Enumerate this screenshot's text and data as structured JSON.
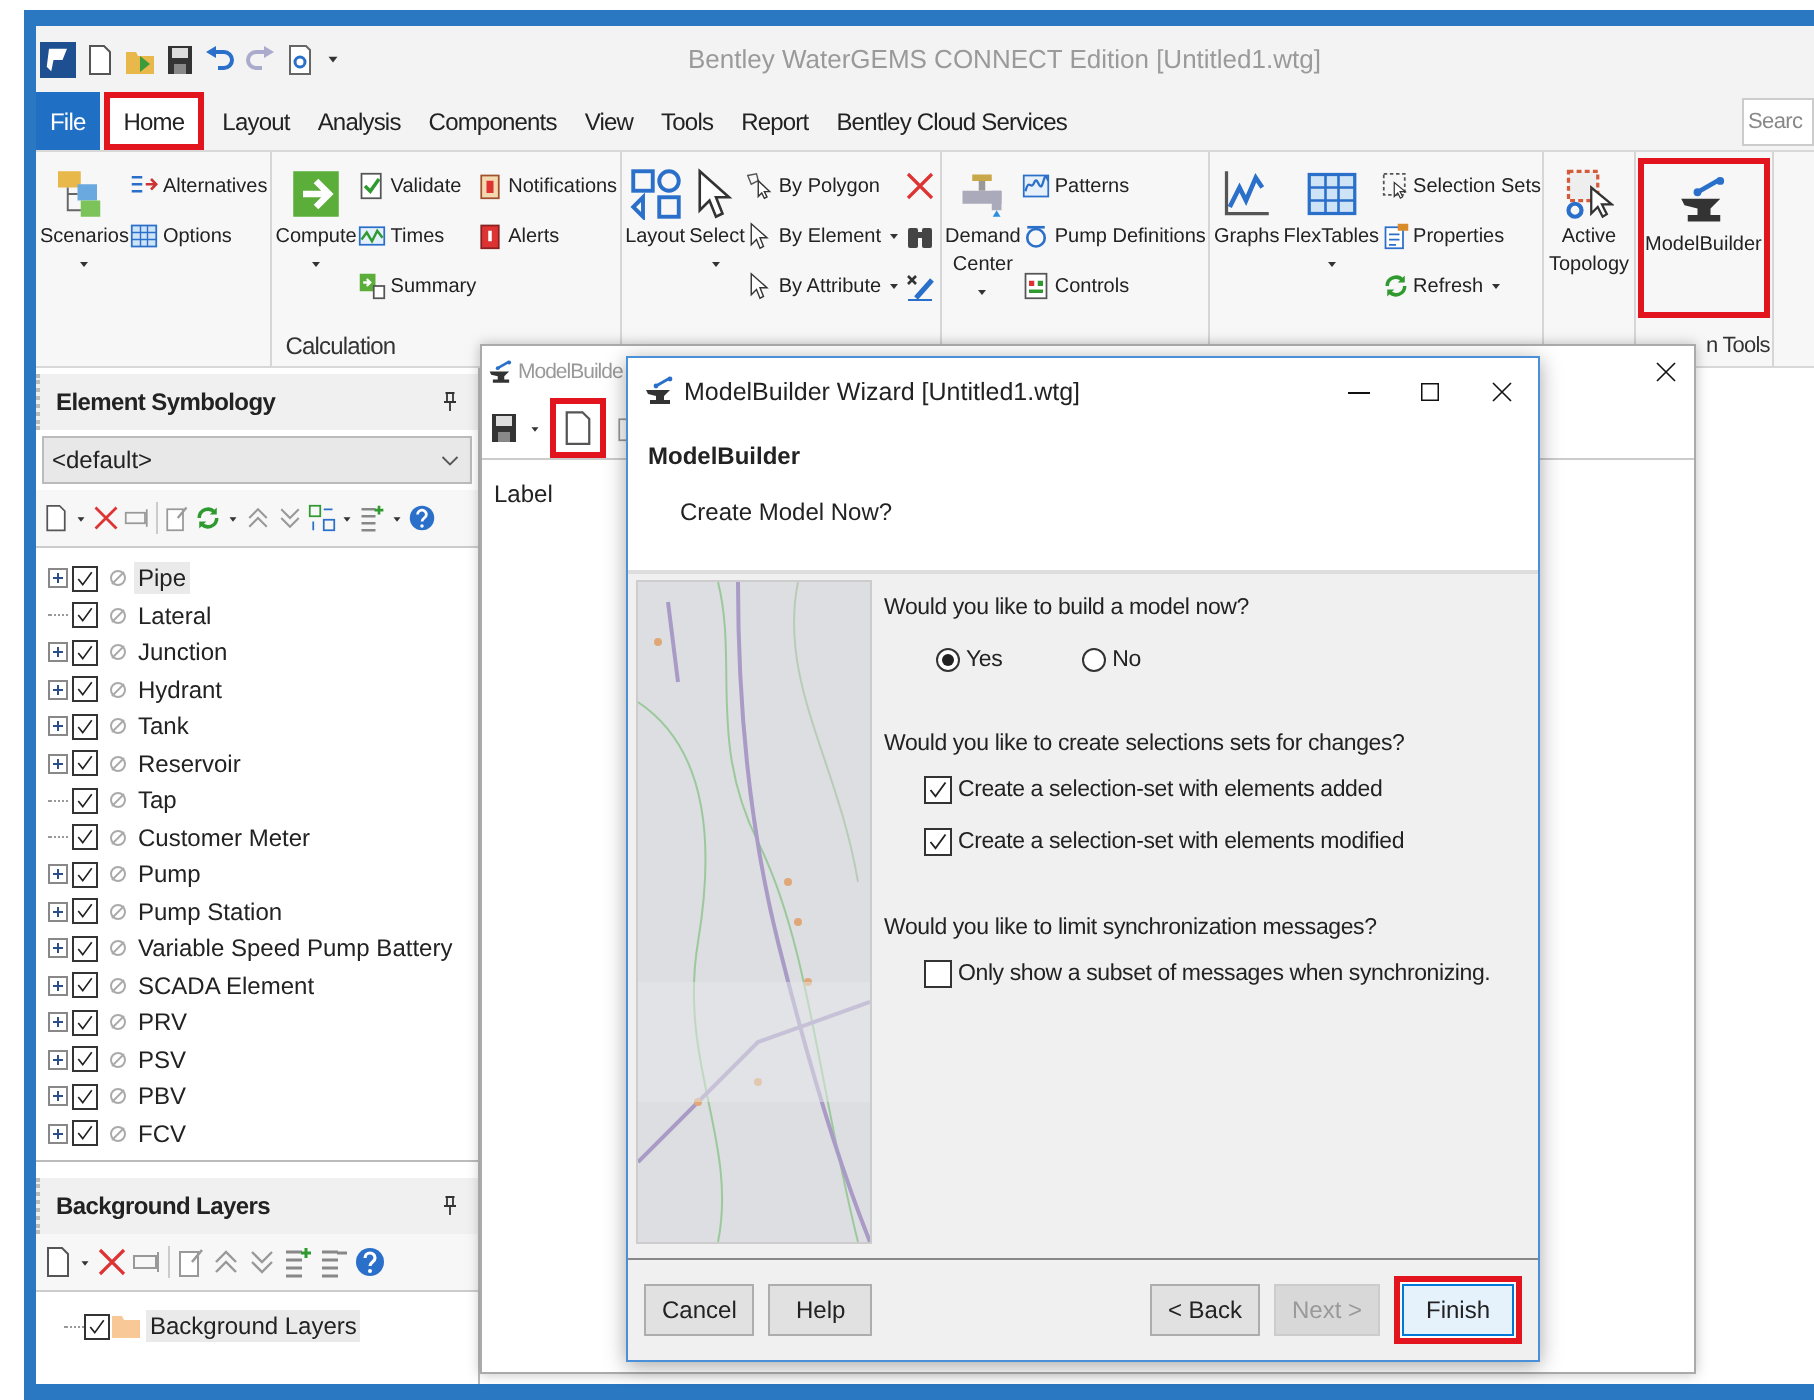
{
  "window": {
    "title": "Bentley WaterGEMS CONNECT Edition [Untitled1.wtg]"
  },
  "menu_tabs": [
    {
      "label": "File",
      "kind": "file",
      "selected": false,
      "highlighted": false
    },
    {
      "label": "Home",
      "kind": "tab",
      "selected": true,
      "highlighted": true
    },
    {
      "label": "Layout",
      "kind": "tab",
      "selected": false,
      "highlighted": false
    },
    {
      "label": "Analysis",
      "kind": "tab",
      "selected": false,
      "highlighted": false
    },
    {
      "label": "Components",
      "kind": "tab",
      "selected": false,
      "highlighted": false
    },
    {
      "label": "View",
      "kind": "tab",
      "selected": false,
      "highlighted": false
    },
    {
      "label": "Tools",
      "kind": "tab",
      "selected": false,
      "highlighted": false
    },
    {
      "label": "Report",
      "kind": "tab",
      "selected": false,
      "highlighted": false
    },
    {
      "label": "Bentley Cloud Services",
      "kind": "tab",
      "selected": false,
      "highlighted": false
    }
  ],
  "search": {
    "placeholder": "Searc"
  },
  "ribbon_groups": [
    {
      "columns": [
        {
          "kind": "large",
          "items": [
            {
              "label": "Scenarios",
              "dropdown": true,
              "highlighted": false
            }
          ]
        },
        {
          "kind": "small",
          "items": [
            {
              "label": "Alternatives",
              "dropdown": false
            },
            {
              "label": "Options",
              "dropdown": false
            }
          ]
        }
      ]
    },
    {
      "label": "Calculation",
      "columns": [
        {
          "kind": "large",
          "items": [
            {
              "label": "Compute",
              "dropdown": true,
              "highlighted": false
            }
          ]
        },
        {
          "kind": "small",
          "items": [
            {
              "label": "Validate",
              "dropdown": false
            },
            {
              "label": "Times",
              "dropdown": false
            },
            {
              "label": "Summary",
              "dropdown": false
            }
          ]
        },
        {
          "kind": "small",
          "items": [
            {
              "label": "Notifications",
              "dropdown": false
            },
            {
              "label": "Alerts",
              "dropdown": false
            }
          ]
        }
      ]
    },
    {
      "columns": [
        {
          "kind": "large",
          "items": [
            {
              "label": "Layout",
              "dropdown": false,
              "highlighted": false
            }
          ]
        },
        {
          "kind": "large",
          "items": [
            {
              "label": "Select",
              "dropdown": true,
              "highlighted": false
            }
          ]
        },
        {
          "kind": "small",
          "items": [
            {
              "label": "By Polygon",
              "dropdown": false
            },
            {
              "label": "By Element",
              "dropdown": true
            },
            {
              "label": "By Attribute",
              "dropdown": true
            }
          ]
        },
        {
          "kind": "icons",
          "items": [
            {
              "dropdown": false
            },
            {
              "dropdown": false
            },
            {
              "dropdown": false
            }
          ]
        }
      ]
    },
    {
      "columns": [
        {
          "kind": "large",
          "items": [
            {
              "label": "Demand Center",
              "dropdown": true,
              "highlighted": false
            }
          ]
        },
        {
          "kind": "small",
          "items": [
            {
              "label": "Patterns",
              "dropdown": false
            },
            {
              "label": "Pump Definitions",
              "dropdown": false
            },
            {
              "label": "Controls",
              "dropdown": false
            }
          ]
        }
      ]
    },
    {
      "columns": [
        {
          "kind": "large",
          "items": [
            {
              "label": "Graphs",
              "dropdown": false,
              "highlighted": false
            }
          ]
        },
        {
          "kind": "large",
          "items": [
            {
              "label": "FlexTables",
              "dropdown": true,
              "highlighted": false
            }
          ]
        },
        {
          "kind": "small",
          "items": [
            {
              "label": "Selection Sets",
              "dropdown": false
            },
            {
              "label": "Properties",
              "dropdown": false
            },
            {
              "label": "Refresh",
              "dropdown": true
            }
          ]
        }
      ]
    },
    {
      "columns": [
        {
          "kind": "large",
          "items": [
            {
              "label": "Active Topology",
              "dropdown": false,
              "highlighted": false
            }
          ]
        }
      ]
    },
    {
      "label": "n Tools",
      "columns": [
        {
          "kind": "large",
          "items": [
            {
              "label": "ModelBuilder",
              "dropdown": false,
              "highlighted": true
            }
          ]
        }
      ]
    }
  ],
  "element_symbology": {
    "title": "Element Symbology",
    "dropdown_value": "<default>",
    "tree": [
      {
        "label": "Pipe",
        "expandable": true,
        "checked": true,
        "selected": true
      },
      {
        "label": "Lateral",
        "expandable": false,
        "checked": true,
        "selected": false
      },
      {
        "label": "Junction",
        "expandable": true,
        "checked": true,
        "selected": false
      },
      {
        "label": "Hydrant",
        "expandable": true,
        "checked": true,
        "selected": false
      },
      {
        "label": "Tank",
        "expandable": true,
        "checked": true,
        "selected": false
      },
      {
        "label": "Reservoir",
        "expandable": true,
        "checked": true,
        "selected": false
      },
      {
        "label": "Tap",
        "expandable": false,
        "checked": true,
        "selected": false
      },
      {
        "label": "Customer Meter",
        "expandable": false,
        "checked": true,
        "selected": false
      },
      {
        "label": "Pump",
        "expandable": true,
        "checked": true,
        "selected": false
      },
      {
        "label": "Pump Station",
        "expandable": true,
        "checked": true,
        "selected": false
      },
      {
        "label": "Variable Speed Pump Battery",
        "expandable": true,
        "checked": true,
        "selected": false
      },
      {
        "label": "SCADA Element",
        "expandable": true,
        "checked": true,
        "selected": false
      },
      {
        "label": "PRV",
        "expandable": true,
        "checked": true,
        "selected": false
      },
      {
        "label": "PSV",
        "expandable": true,
        "checked": true,
        "selected": false
      },
      {
        "label": "PBV",
        "expandable": true,
        "checked": true,
        "selected": false
      },
      {
        "label": "FCV",
        "expandable": true,
        "checked": true,
        "selected": false
      }
    ]
  },
  "background_layers": {
    "title": "Background Layers",
    "tree": [
      {
        "label": "Background Layers",
        "checked": true,
        "selected": true
      }
    ]
  },
  "modelbuilder_window": {
    "title": "ModelBuilde",
    "new_button_highlighted": true,
    "column_header": "Label"
  },
  "wizard": {
    "title": "ModelBuilder Wizard [Untitled1.wtg]",
    "heading": "ModelBuilder",
    "subheading": "Create Model Now?",
    "questions": [
      {
        "kind": "radio",
        "question": "Would you like to build a model now?",
        "options": [
          {
            "label": "Yes",
            "selected": true
          },
          {
            "label": "No",
            "selected": false
          }
        ]
      },
      {
        "kind": "checks",
        "question": "Would you like to create selections sets for changes?",
        "options": [
          {
            "label": "Create a selection-set with elements added",
            "checked": true
          },
          {
            "label": "Create a selection-set with elements modified",
            "checked": true
          }
        ]
      },
      {
        "kind": "checks",
        "question": "Would you like to limit synchronization messages?",
        "options": [
          {
            "label": "Only show a subset of messages when synchronizing.",
            "checked": false
          }
        ]
      }
    ],
    "left_buttons": [
      {
        "label": "Cancel",
        "disabled": false,
        "highlighted": false
      },
      {
        "label": "Help",
        "disabled": false,
        "highlighted": false
      }
    ],
    "right_buttons": [
      {
        "label": "< Back",
        "disabled": false,
        "highlighted": false
      },
      {
        "label": "Next >",
        "disabled": true,
        "highlighted": false
      },
      {
        "label": "Finish",
        "disabled": false,
        "highlighted": true
      }
    ]
  }
}
